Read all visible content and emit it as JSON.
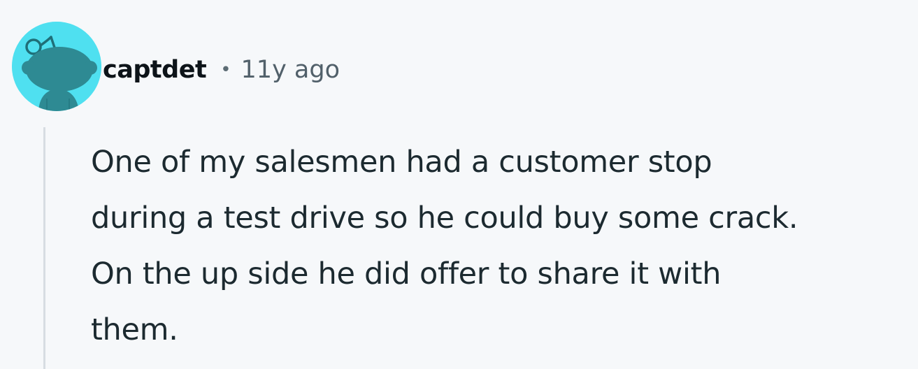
{
  "comment": {
    "username": "captdet",
    "separator": "•",
    "timestamp": "11y ago",
    "avatar_icon": "reddit-snoo-avatar-icon",
    "avatar_color": "#4fe0f0",
    "body_lines": [
      "One of my salesmen had a customer stop",
      "during a test drive so he could buy some crack.",
      "On the up side he did offer to share it with",
      "them."
    ]
  }
}
